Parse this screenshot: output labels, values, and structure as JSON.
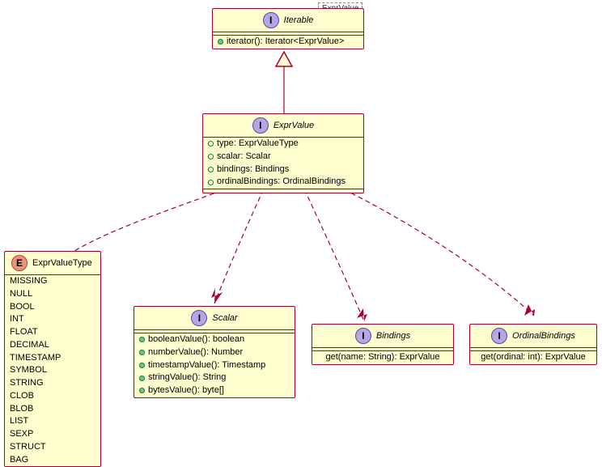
{
  "package_label": "ExprValue",
  "iterable": {
    "title": "Iterable",
    "method": "iterator(): Iterator<ExprValue>"
  },
  "exprValue": {
    "title": "ExprValue",
    "props": [
      "type: ExprValueType",
      "scalar: Scalar",
      "bindings: Bindings",
      "ordinalBindings: OrdinalBindings"
    ]
  },
  "exprValueType": {
    "title": "ExprValueType",
    "literals": [
      "MISSING",
      "NULL",
      "BOOL",
      "INT",
      "FLOAT",
      "DECIMAL",
      "TIMESTAMP",
      "SYMBOL",
      "STRING",
      "CLOB",
      "BLOB",
      "LIST",
      "SEXP",
      "STRUCT",
      "BAG"
    ]
  },
  "scalar": {
    "title": "Scalar",
    "methods": [
      "booleanValue(): boolean",
      "numberValue(): Number",
      "timestampValue(): Timestamp",
      "stringValue(): String",
      "bytesValue(): byte[]"
    ]
  },
  "bindings": {
    "title": "Bindings",
    "method": "get(name: String): ExprValue"
  },
  "ordinalBindings": {
    "title": "OrdinalBindings",
    "method": "get(ordinal: int): ExprValue"
  }
}
